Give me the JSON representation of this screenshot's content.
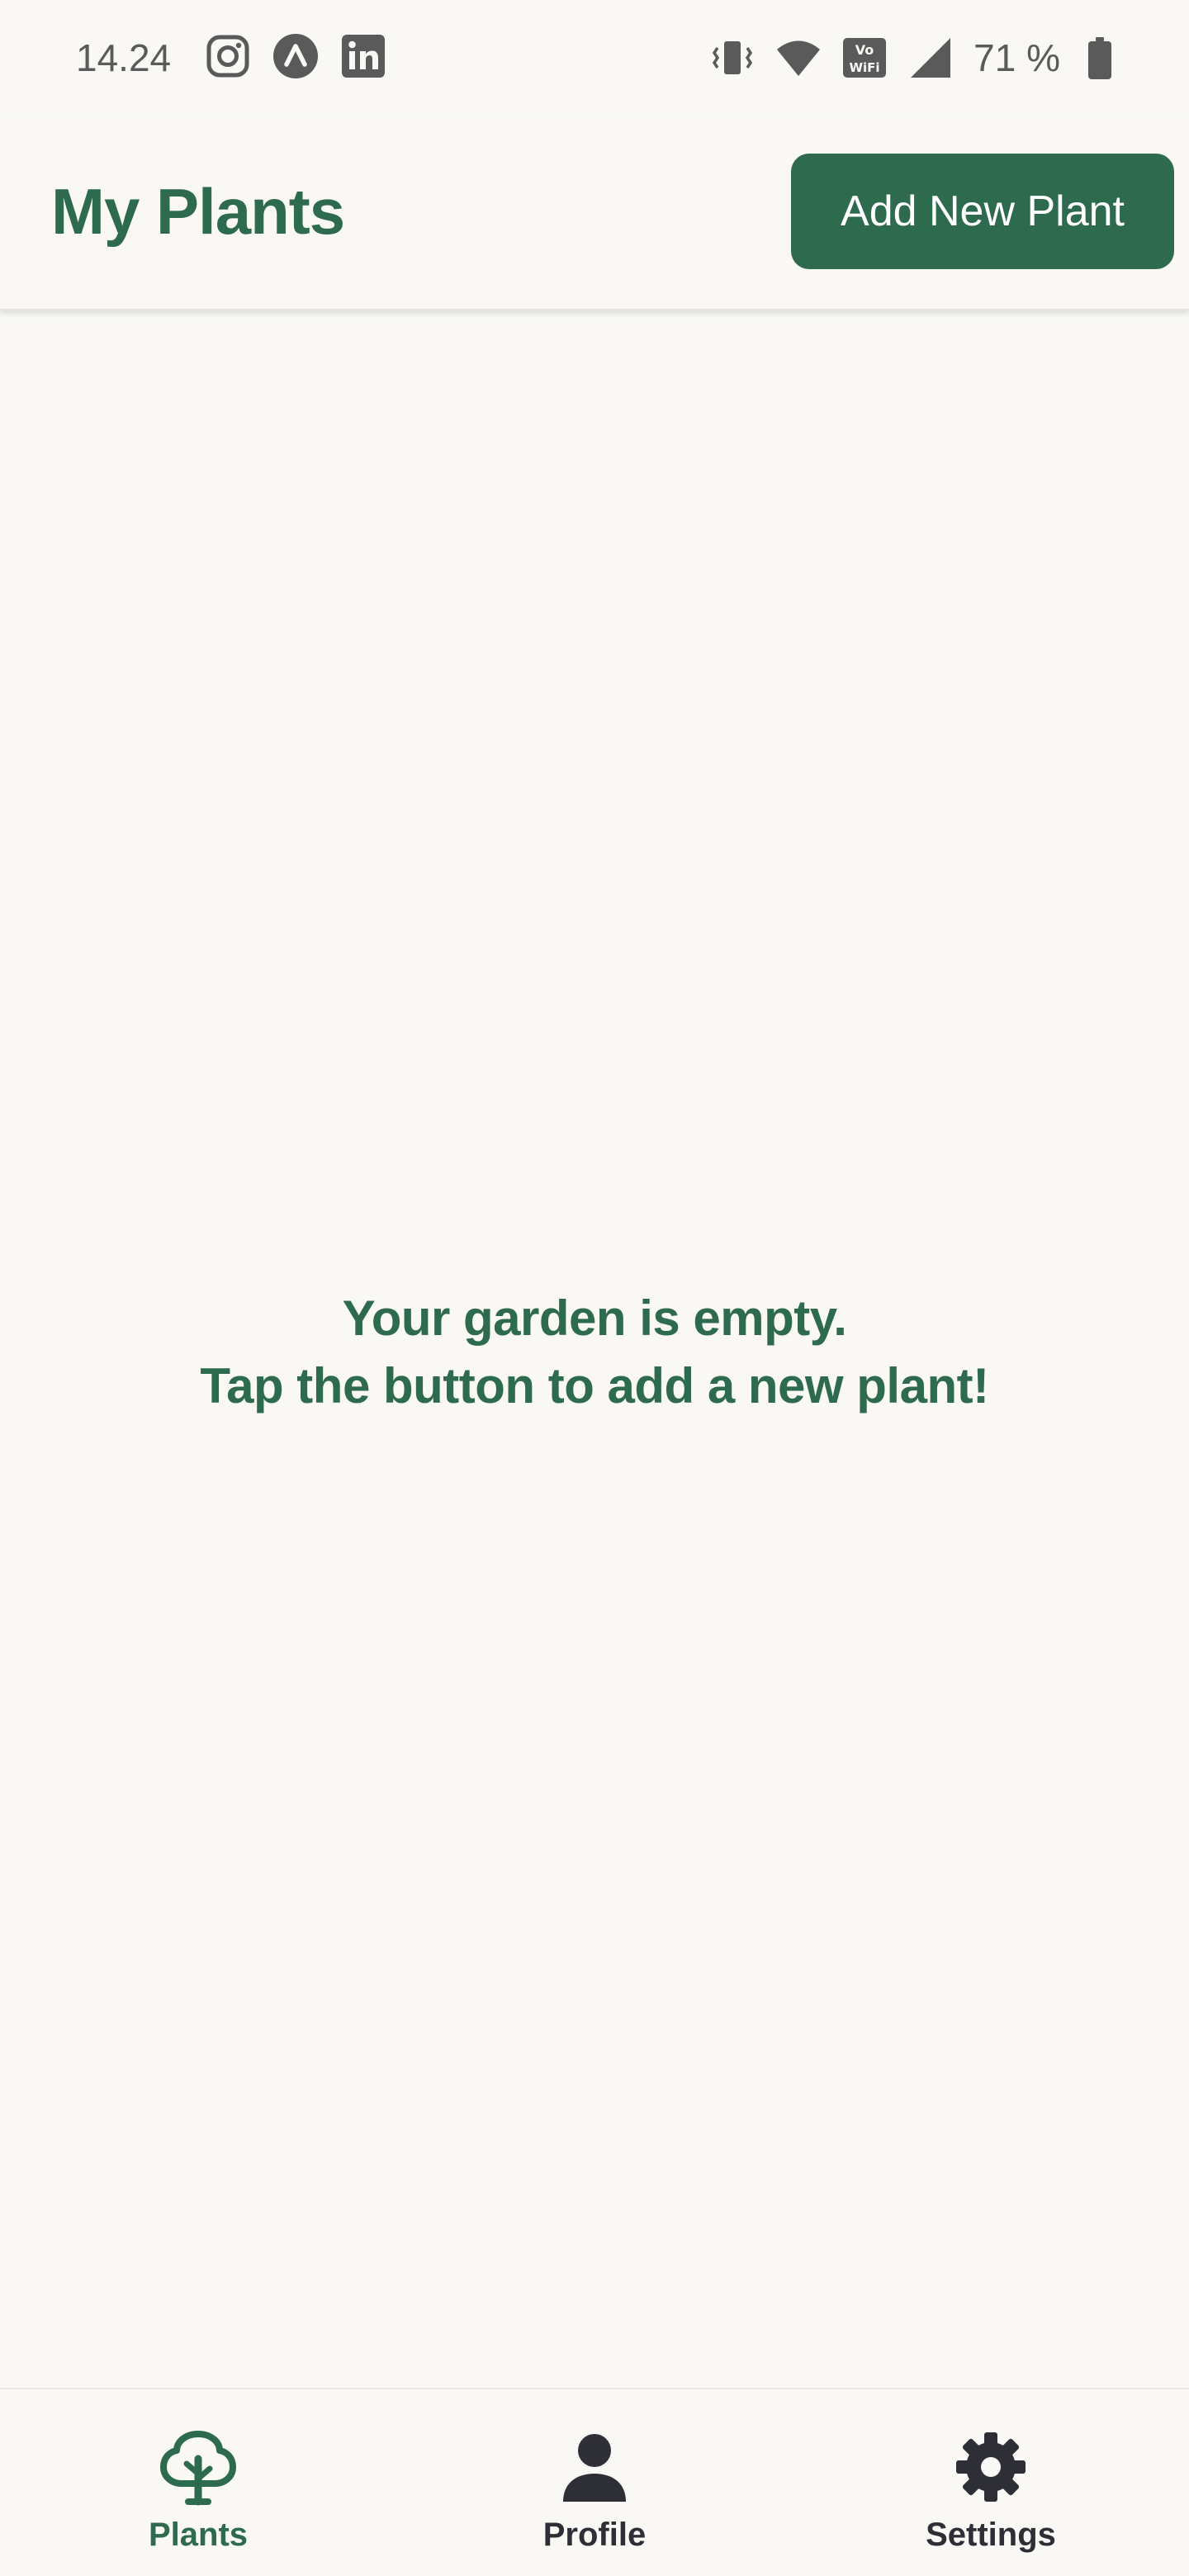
{
  "status_bar": {
    "time": "14.24",
    "battery_percent": "71 %",
    "notification_icons": [
      "instagram-icon",
      "expo-icon",
      "linkedin-icon"
    ],
    "system_icons": [
      "vibrate-icon",
      "wifi-icon",
      "vowifi-icon",
      "signal-icon",
      "battery-icon"
    ]
  },
  "header": {
    "title": "My Plants",
    "add_button_label": "Add New Plant"
  },
  "empty_state": {
    "line1": "Your garden is empty.",
    "line2": "Tap the button to add a new plant!"
  },
  "bottom_nav": {
    "items": [
      {
        "label": "Plants",
        "icon": "tree-icon",
        "active": true
      },
      {
        "label": "Profile",
        "icon": "person-icon",
        "active": false
      },
      {
        "label": "Settings",
        "icon": "gear-icon",
        "active": false
      }
    ]
  },
  "colors": {
    "primary": "#2e6a4e",
    "background": "#f9f8f5",
    "inactive_nav": "#2e2f36",
    "status_text": "#5a5a5a"
  }
}
